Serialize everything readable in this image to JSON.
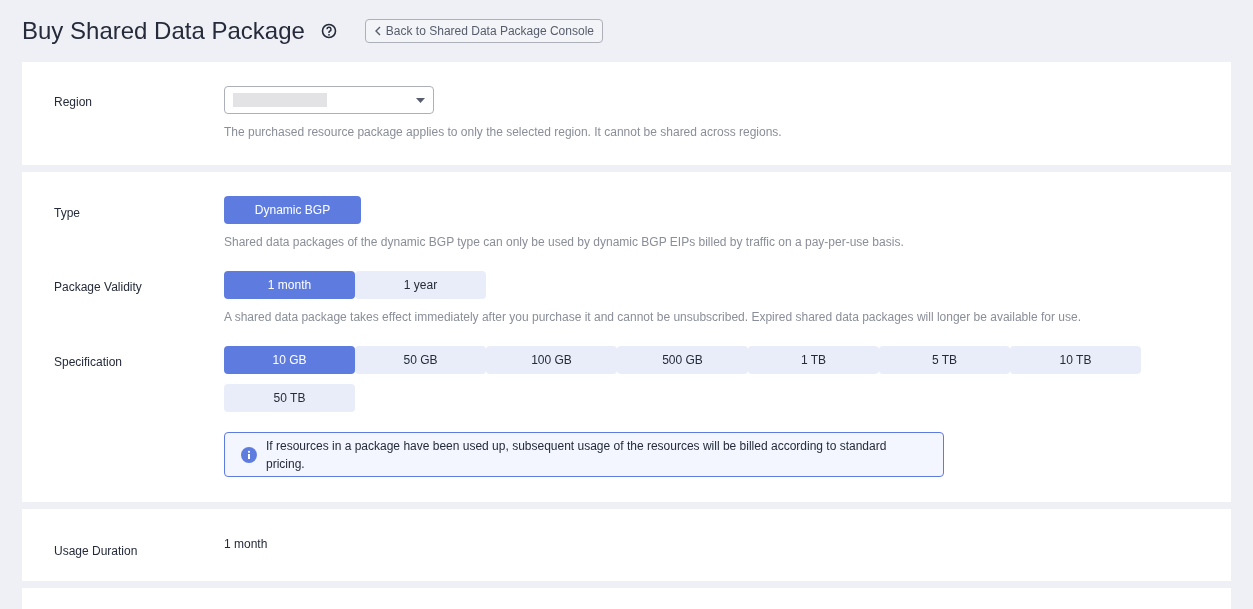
{
  "page": {
    "title": "Buy Shared Data Package",
    "back_button": "Back to Shared Data Package Console"
  },
  "region": {
    "label": "Region",
    "hint": "The purchased resource package applies to only the selected region. It cannot be shared across regions."
  },
  "type": {
    "label": "Type",
    "options": [
      {
        "label": "Dynamic BGP",
        "selected": true
      }
    ],
    "hint": "Shared data packages of the dynamic BGP type can only be used by dynamic BGP EIPs billed by traffic on a pay-per-use basis."
  },
  "validity": {
    "label": "Package Validity",
    "options": [
      {
        "label": "1 month",
        "selected": true
      },
      {
        "label": "1 year",
        "selected": false
      }
    ],
    "hint": "A shared data package takes effect immediately after you purchase it and cannot be unsubscribed. Expired shared data packages will longer be available for use."
  },
  "specification": {
    "label": "Specification",
    "options": [
      {
        "label": "10 GB",
        "selected": true
      },
      {
        "label": "50 GB",
        "selected": false
      },
      {
        "label": "100 GB",
        "selected": false
      },
      {
        "label": "500 GB",
        "selected": false
      },
      {
        "label": "1 TB",
        "selected": false
      },
      {
        "label": "5 TB",
        "selected": false
      },
      {
        "label": "10 TB",
        "selected": false
      },
      {
        "label": "50 TB",
        "selected": false
      }
    ],
    "notice": "If resources in a package have been used up, subsequent usage of the resources will be billed according to standard pricing."
  },
  "usage_duration": {
    "label": "Usage Duration",
    "value": "1 month"
  }
}
